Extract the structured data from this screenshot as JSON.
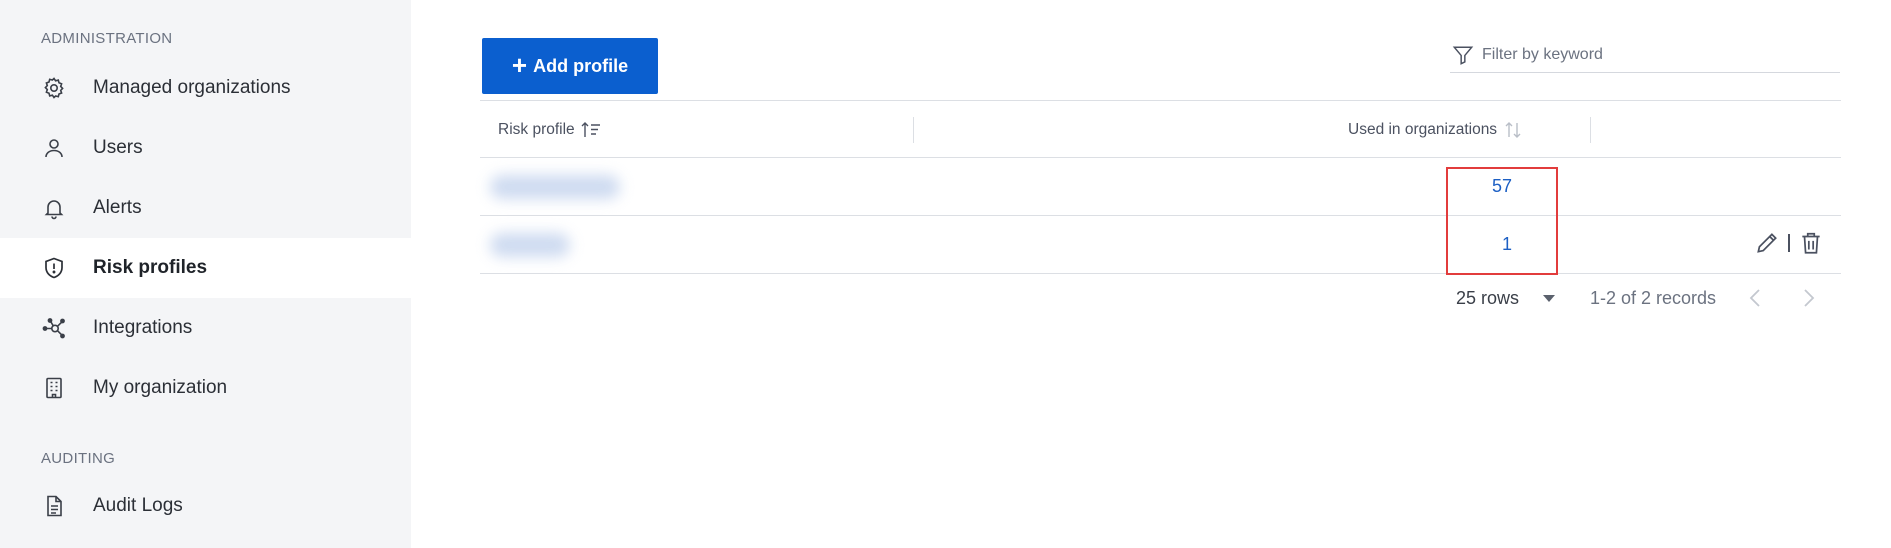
{
  "sidebar": {
    "section_admin": "ADMINISTRATION",
    "items": [
      {
        "label": "Managed organizations",
        "icon": "gear-icon"
      },
      {
        "label": "Users",
        "icon": "user-icon"
      },
      {
        "label": "Alerts",
        "icon": "bell-icon"
      },
      {
        "label": "Risk profiles",
        "icon": "shield-icon",
        "active": true
      },
      {
        "label": "Integrations",
        "icon": "integrations-icon"
      },
      {
        "label": "My organization",
        "icon": "building-icon"
      }
    ],
    "section_auditing": "AUDITING",
    "audit_items": [
      {
        "label": "Audit Logs",
        "icon": "document-icon"
      }
    ]
  },
  "toolbar": {
    "add_label": "Add profile",
    "filter_placeholder": "Filter by keyword"
  },
  "table": {
    "columns": [
      "Risk profile",
      "Used in organizations"
    ],
    "rows": [
      {
        "count": "57"
      },
      {
        "count": "1"
      }
    ]
  },
  "pagination": {
    "rows_per_page": "25 rows",
    "records": "1-2 of 2 records"
  },
  "colors": {
    "accent": "#0b5fcf",
    "link": "#1c5fc4",
    "highlight": "#e23c3c",
    "sidebar_bg": "#f4f5f7"
  }
}
